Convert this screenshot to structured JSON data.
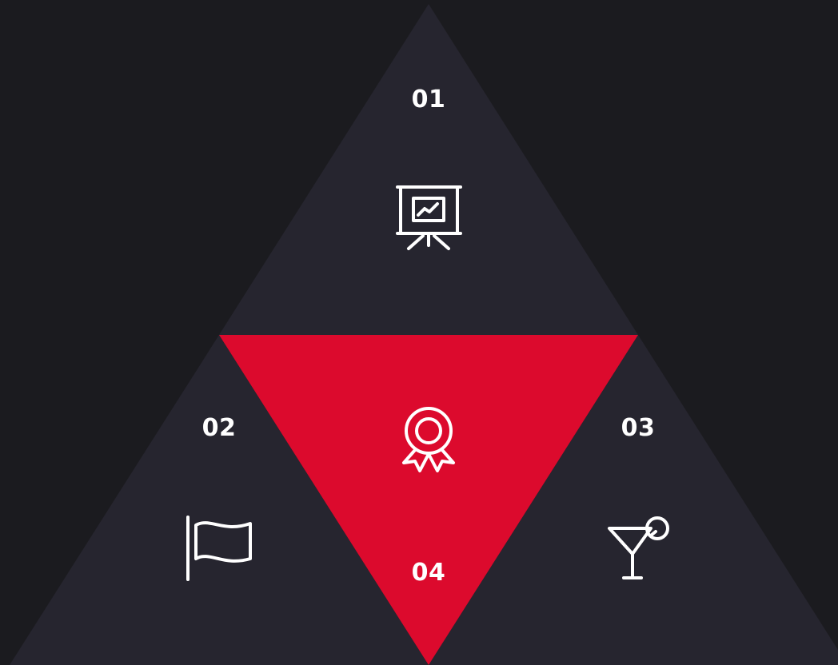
{
  "colors": {
    "background": "#1b1b1f",
    "segment": "#26252f",
    "accent": "#dc0a2d",
    "icon_stroke": "#ffffff",
    "text": "#ffffff"
  },
  "segments": [
    {
      "number": "01",
      "icon": "presentation-board-chart-icon"
    },
    {
      "number": "02",
      "icon": "flag-icon"
    },
    {
      "number": "03",
      "icon": "cocktail-glass-icon"
    },
    {
      "number": "04",
      "icon": "award-ribbon-badge-icon"
    }
  ]
}
